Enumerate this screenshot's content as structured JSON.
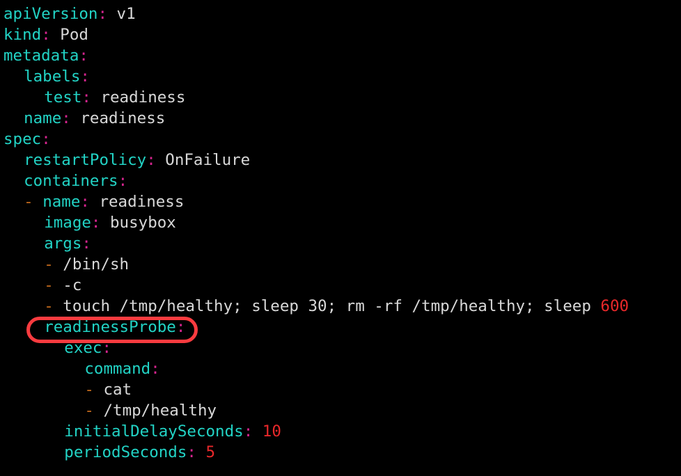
{
  "editor": {
    "language": "yaml",
    "background_color": "#000000",
    "theme": {
      "key_color": "#22d3c5",
      "colon_color": "#d6258f",
      "value_color": "#d8d8d8",
      "dash_color": "#c2691c",
      "number_color": "#e8282a",
      "highlight_color": "#f93b3f"
    }
  },
  "annotation": {
    "shape": "rounded-rectangle",
    "target_text": "readinessProbe:",
    "color": "#f93b3f"
  },
  "document": {
    "lines": [
      {
        "indent": 0,
        "dash": "",
        "key": "apiVersion",
        "colon": ":",
        "value": " v1",
        "value_kind": "plain"
      },
      {
        "indent": 0,
        "dash": "",
        "key": "kind",
        "colon": ":",
        "value": " Pod",
        "value_kind": "plain"
      },
      {
        "indent": 0,
        "dash": "",
        "key": "metadata",
        "colon": ":",
        "value": "",
        "value_kind": "plain"
      },
      {
        "indent": 2,
        "dash": "",
        "key": "labels",
        "colon": ":",
        "value": "",
        "value_kind": "plain"
      },
      {
        "indent": 4,
        "dash": "",
        "key": "test",
        "colon": ":",
        "value": " readiness",
        "value_kind": "plain"
      },
      {
        "indent": 2,
        "dash": "",
        "key": "name",
        "colon": ":",
        "value": " readiness",
        "value_kind": "plain"
      },
      {
        "indent": 0,
        "dash": "",
        "key": "spec",
        "colon": ":",
        "value": "",
        "value_kind": "plain"
      },
      {
        "indent": 2,
        "dash": "",
        "key": "restartPolicy",
        "colon": ":",
        "value": " OnFailure",
        "value_kind": "plain"
      },
      {
        "indent": 2,
        "dash": "",
        "key": "containers",
        "colon": ":",
        "value": "",
        "value_kind": "plain"
      },
      {
        "indent": 2,
        "dash": "- ",
        "key": "name",
        "colon": ":",
        "value": " readiness",
        "value_kind": "plain"
      },
      {
        "indent": 4,
        "dash": "",
        "key": "image",
        "colon": ":",
        "value": " busybox",
        "value_kind": "plain"
      },
      {
        "indent": 4,
        "dash": "",
        "key": "args",
        "colon": ":",
        "value": "",
        "value_kind": "plain"
      },
      {
        "indent": 4,
        "dash": "- ",
        "key": "",
        "colon": "",
        "value": "/bin/sh",
        "value_kind": "plain"
      },
      {
        "indent": 4,
        "dash": "- ",
        "key": "",
        "colon": "",
        "value": "-c",
        "value_kind": "plain"
      },
      {
        "indent": 4,
        "dash": "- ",
        "key": "",
        "colon": "",
        "value": "touch /tmp/healthy; sleep 30; rm -rf /tmp/healthy; sleep ",
        "value_kind": "plain",
        "trailing_number": "600"
      },
      {
        "indent": 4,
        "dash": "",
        "key": "readinessProbe",
        "colon": ":",
        "value": "",
        "value_kind": "plain",
        "highlighted": true
      },
      {
        "indent": 6,
        "dash": "",
        "key": "exec",
        "colon": ":",
        "value": "",
        "value_kind": "plain"
      },
      {
        "indent": 8,
        "dash": "",
        "key": "command",
        "colon": ":",
        "value": "",
        "value_kind": "plain"
      },
      {
        "indent": 8,
        "dash": "- ",
        "key": "",
        "colon": "",
        "value": "cat",
        "value_kind": "plain"
      },
      {
        "indent": 8,
        "dash": "- ",
        "key": "",
        "colon": "",
        "value": "/tmp/healthy",
        "value_kind": "plain"
      },
      {
        "indent": 6,
        "dash": "",
        "key": "initialDelaySeconds",
        "colon": ":",
        "value": " ",
        "value_kind": "number",
        "number": "10"
      },
      {
        "indent": 6,
        "dash": "",
        "key": "periodSeconds",
        "colon": ":",
        "value": " ",
        "value_kind": "number",
        "number": "5"
      }
    ]
  }
}
